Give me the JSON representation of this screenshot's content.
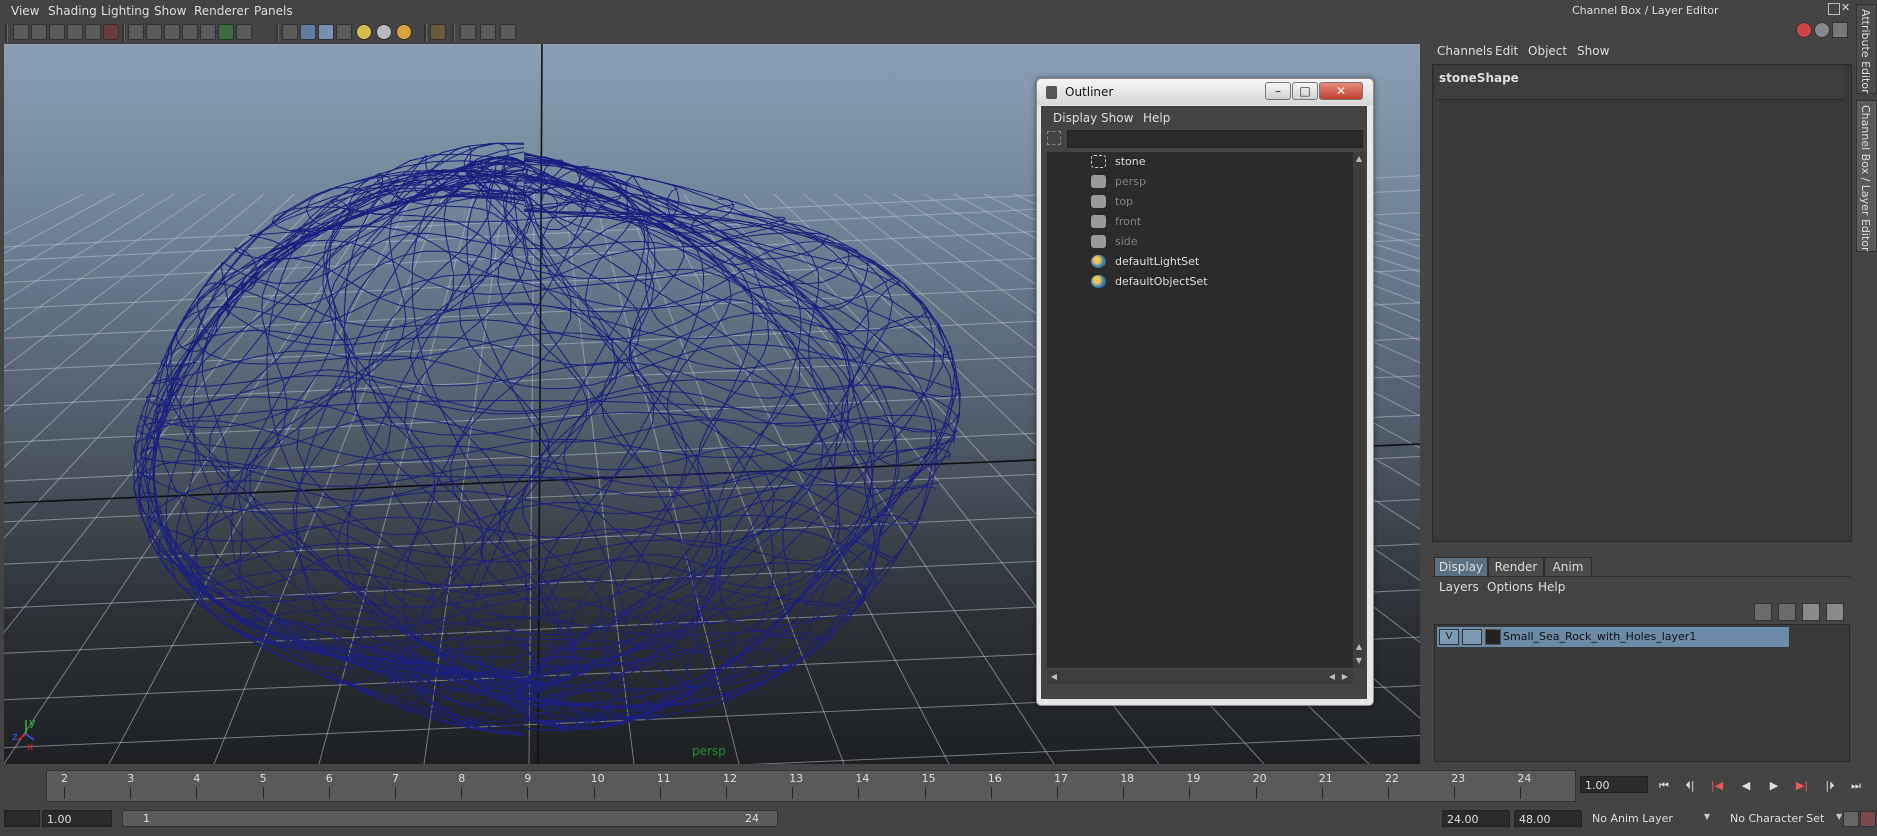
{
  "menubar": {
    "items": [
      "View",
      "Shading",
      "Lighting",
      "Show",
      "Renderer",
      "Panels"
    ]
  },
  "channel_box": {
    "title": "Channel Box / Layer Editor",
    "menu": [
      "Channels",
      "Edit",
      "Object",
      "Show"
    ],
    "object_name": "stoneShape"
  },
  "side_tabs": {
    "attribute_editor": "Attribute Editor",
    "channel_box": "Channel Box / Layer Editor"
  },
  "layer_editor": {
    "tabs": [
      "Display",
      "Render",
      "Anim"
    ],
    "active_tab": "Display",
    "menu": [
      "Layers",
      "Options",
      "Help"
    ],
    "layer": {
      "visible": "V",
      "name": "Small_Sea_Rock_with_Holes_layer1"
    }
  },
  "viewport": {
    "camera_label": "persp",
    "axis_y": "y",
    "axis_x": "x",
    "axis_z": "z",
    "wire_color": "#1a2080"
  },
  "outliner": {
    "title": "Outliner",
    "menu": [
      "Display",
      "Show",
      "Help"
    ],
    "items": [
      {
        "name": "stone",
        "icon": "mesh-icon",
        "state": "bright"
      },
      {
        "name": "persp",
        "icon": "camera-icon",
        "state": "dim"
      },
      {
        "name": "top",
        "icon": "camera-icon",
        "state": "dim"
      },
      {
        "name": "front",
        "icon": "camera-icon",
        "state": "dim"
      },
      {
        "name": "side",
        "icon": "camera-icon",
        "state": "dim"
      },
      {
        "name": "defaultLightSet",
        "icon": "set-icon",
        "state": "bright"
      },
      {
        "name": "defaultObjectSet",
        "icon": "set-icon",
        "state": "bright"
      }
    ]
  },
  "time_slider": {
    "ticks": [
      "2",
      "3",
      "4",
      "5",
      "6",
      "7",
      "8",
      "9",
      "10",
      "11",
      "12",
      "13",
      "14",
      "15",
      "16",
      "17",
      "18",
      "19",
      "20",
      "21",
      "22",
      "23",
      "24"
    ],
    "current_frame": "1.00"
  },
  "range": {
    "start_time": "1.00",
    "range_start": "1",
    "range_end": "24",
    "end_time": "24.00",
    "max_time": "48.00",
    "anim_layer": "No Anim Layer",
    "character_set": "No Character Set"
  }
}
